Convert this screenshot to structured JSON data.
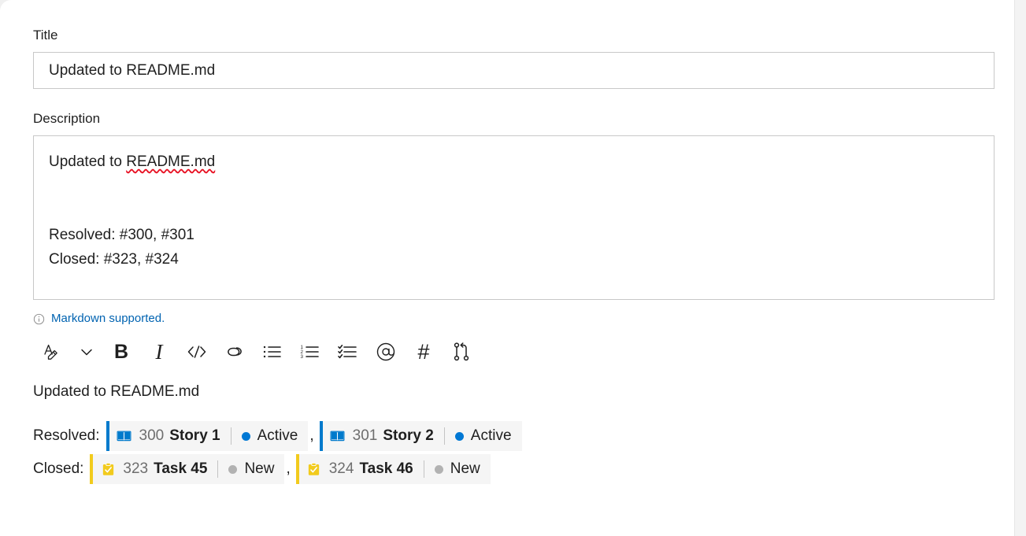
{
  "form": {
    "title_label": "Title",
    "title_value": "Updated to README.md",
    "description_label": "Description",
    "description_line1_prefix": "Updated to ",
    "description_line1_misspelled": "README.md",
    "description_line2": "Resolved: #300, #301",
    "description_line3": "Closed: #323, #324"
  },
  "markdown_note": {
    "icon": "info-icon",
    "text": "Markdown supported."
  },
  "toolbar": {
    "buttons": [
      {
        "name": "font-style-icon",
        "label": "A",
        "kind": "svg-font"
      },
      {
        "name": "chevron-down-icon",
        "label": "",
        "kind": "svg-chevron"
      },
      {
        "name": "bold-icon",
        "label": "B",
        "kind": "glyph-bold"
      },
      {
        "name": "italic-icon",
        "label": "I",
        "kind": "glyph-italic"
      },
      {
        "name": "code-icon",
        "label": "</>",
        "kind": "svg-code"
      },
      {
        "name": "link-icon",
        "label": "",
        "kind": "svg-link"
      },
      {
        "name": "bulleted-list-icon",
        "label": "",
        "kind": "svg-ul"
      },
      {
        "name": "numbered-list-icon",
        "label": "",
        "kind": "svg-ol"
      },
      {
        "name": "checklist-icon",
        "label": "",
        "kind": "svg-check-list"
      },
      {
        "name": "mention-icon",
        "label": "@",
        "kind": "svg-at"
      },
      {
        "name": "hashtag-icon",
        "label": "#",
        "kind": "glyph-hash"
      },
      {
        "name": "pull-request-icon",
        "label": "",
        "kind": "svg-pr"
      }
    ]
  },
  "preview": {
    "heading": "Updated to README.md",
    "rows": [
      {
        "label": "Resolved:",
        "items": [
          {
            "type": "Story",
            "icon": "story-icon",
            "accent": "#007acc",
            "id": "300",
            "title": "Story 1",
            "state": "Active",
            "state_color": "#0078d4"
          },
          {
            "type": "Story",
            "icon": "story-icon",
            "accent": "#007acc",
            "id": "301",
            "title": "Story 2",
            "state": "Active",
            "state_color": "#0078d4"
          }
        ],
        "separator": ","
      },
      {
        "label": "Closed:",
        "items": [
          {
            "type": "Task",
            "icon": "task-icon",
            "accent": "#f2cb1d",
            "id": "323",
            "title": "Task 45",
            "state": "New",
            "state_color": "#b2b2b2"
          },
          {
            "type": "Task",
            "icon": "task-icon",
            "accent": "#f2cb1d",
            "id": "324",
            "title": "Task 46",
            "state": "New",
            "state_color": "#b2b2b2"
          }
        ],
        "separator": ","
      }
    ]
  }
}
